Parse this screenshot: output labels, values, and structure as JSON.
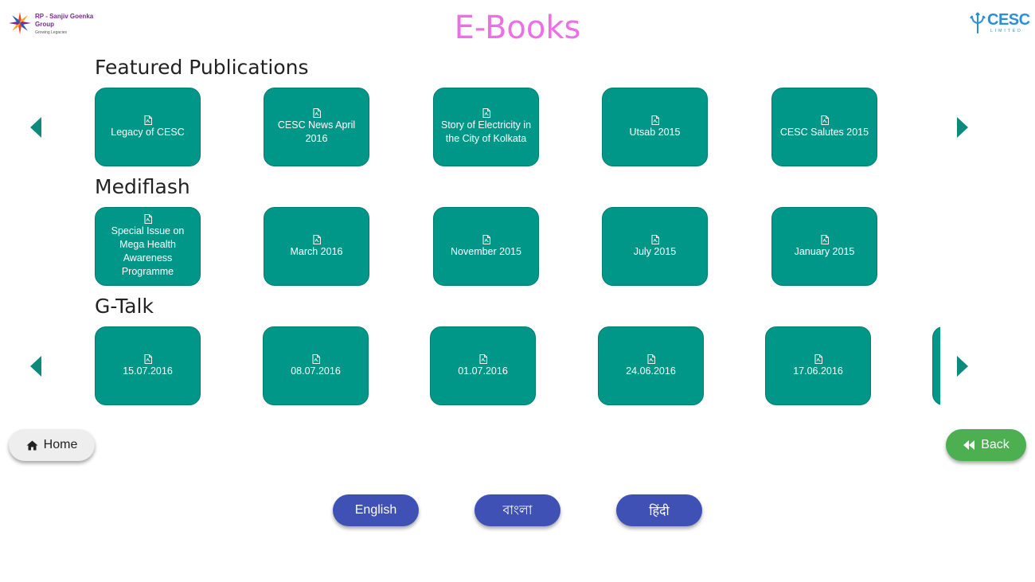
{
  "header": {
    "title": "E-Books",
    "logo_left": {
      "line1": "RP - Sanjiv Goenka",
      "line2": "Group",
      "tagline": "Growing Legacies"
    },
    "logo_right": {
      "name": "CESC",
      "sub": "LIMITED"
    }
  },
  "sections": [
    {
      "title": "Featured Publications",
      "items": [
        "Legacy of CESC",
        "CESC News April 2016",
        "Story of Electricity in the City of Kolkata",
        "Utsab 2015",
        "CESC Salutes 2015"
      ]
    },
    {
      "title": "Mediflash",
      "items": [
        "Special Issue on Mega Health Awareness Programme",
        "March 2016",
        "November 2015",
        "July 2015",
        "January 2015"
      ]
    },
    {
      "title": "G-Talk",
      "items": [
        "15.07.2016",
        "08.07.2016",
        "01.07.2016",
        "24.06.2016",
        "17.06.2016",
        ""
      ]
    }
  ],
  "nav": {
    "home_label": "Home",
    "back_label": "Back"
  },
  "languages": [
    "English",
    "বাংলা",
    "हिंदी"
  ],
  "colors": {
    "tile": "#009688",
    "title": "#ef6ee6",
    "back": "#4caf50",
    "lang": "#3f51b5",
    "home": "#eeeeee"
  },
  "icons": {
    "tile": "pdf-file-icon",
    "home": "home-icon",
    "back": "fast-backward-icon"
  }
}
